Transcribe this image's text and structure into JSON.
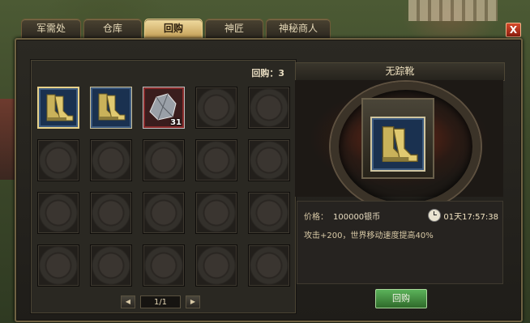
{
  "tabs": [
    {
      "label": "军需处"
    },
    {
      "label": "仓库"
    },
    {
      "label": "回购"
    },
    {
      "label": "神匠"
    },
    {
      "label": "神秘商人"
    }
  ],
  "active_tab": "回购",
  "close_label": "X",
  "buyback": {
    "count_label": "回购：3",
    "slots": [
      {
        "item": "boots-icon",
        "selected": true
      },
      {
        "item": "boots-icon",
        "selected": false
      },
      {
        "item": "ore-icon",
        "quantity": "31"
      }
    ],
    "page_indicator": "1/1"
  },
  "detail": {
    "item_name": "无踪靴",
    "price_label": "价格：",
    "price_value": "100000银币",
    "timer": "01天17:57:38",
    "description": "攻击+200，世界移动速度提高40%",
    "buy_button": "回购"
  },
  "colors": {
    "accent_gold": "#e8d28a",
    "buy_green": "#4a9a44",
    "close_red": "#c43a22"
  }
}
